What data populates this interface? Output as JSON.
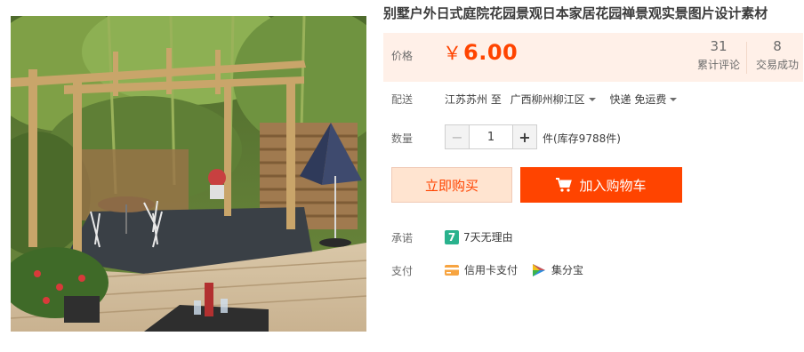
{
  "product": {
    "title": "别墅户外日式庭院花园景观日本家居花园禅景观实景图片设计素材"
  },
  "price": {
    "label": "价格",
    "currency": "￥",
    "value": "6.00",
    "accent_color": "#ff4400"
  },
  "stats": {
    "reviews_count": "31",
    "reviews_label": "累计评论",
    "trades_count": "8",
    "trades_label": "交易成功"
  },
  "shipping": {
    "label": "配送",
    "from": "江苏苏州 至",
    "to": "广西柳州柳江区",
    "method": "快递 免运费"
  },
  "quantity": {
    "label": "数量",
    "value": "1",
    "minus": "−",
    "plus": "+",
    "stock": "件(库存9788件)"
  },
  "actions": {
    "buy_now": "立即购买",
    "add_to_cart": "加入购物车"
  },
  "promise": {
    "label": "承诺",
    "badge": "7",
    "text": "7天无理由"
  },
  "payment": {
    "label": "支付",
    "methods": [
      {
        "icon": "credit-card-icon",
        "text": "信用卡支付"
      },
      {
        "icon": "jifenbao-icon",
        "text": "集分宝"
      }
    ]
  }
}
